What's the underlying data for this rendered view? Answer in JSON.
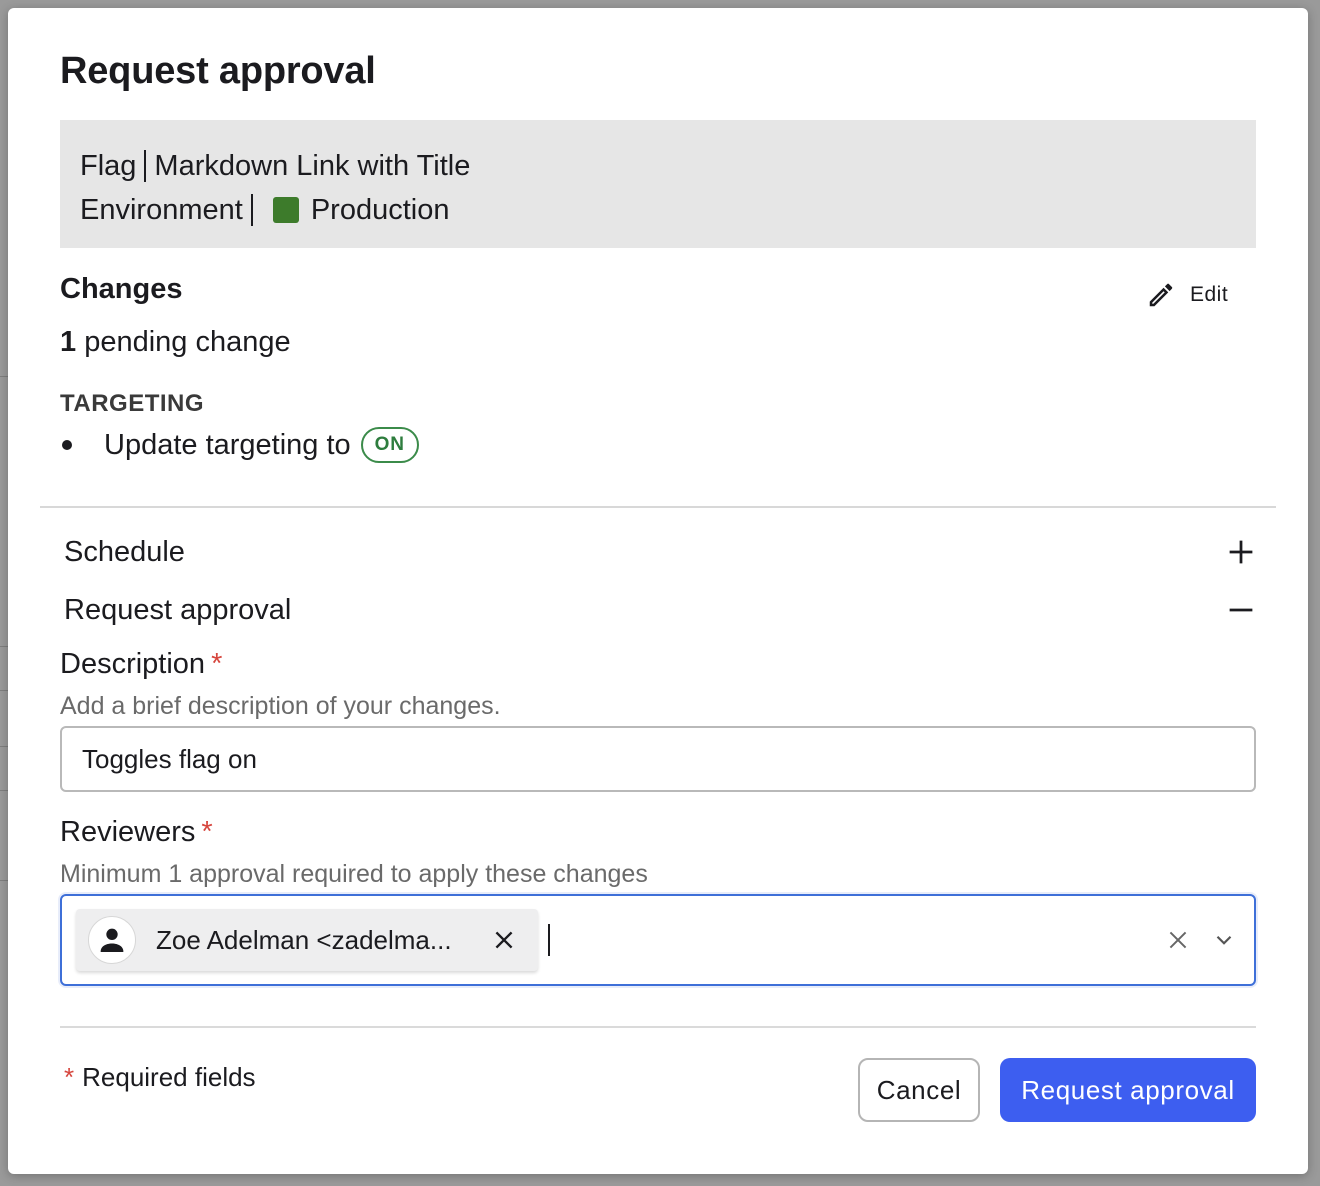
{
  "modal": {
    "title": "Request approval"
  },
  "summary": {
    "flag_label": "Flag",
    "flag_name": "Markdown Link with Title",
    "environment_label": "Environment",
    "environment_name": "Production",
    "environment_color": "#3d7b2b"
  },
  "changes": {
    "heading": "Changes",
    "edit_label": "Edit",
    "pending_count": "1",
    "pending_text": "pending change",
    "section_heading": "TARGETING",
    "item_text": "Update targeting to",
    "item_badge": "ON"
  },
  "accordion": {
    "schedule_label": "Schedule",
    "request_label": "Request approval"
  },
  "description": {
    "label": "Description",
    "required_mark": "*",
    "hint": "Add a brief description of your changes.",
    "value": "Toggles flag on"
  },
  "reviewers": {
    "label": "Reviewers",
    "required_mark": "*",
    "hint": "Minimum 1 approval required to apply these changes",
    "selected": [
      {
        "label": "Zoe Adelman <zadelma..."
      }
    ]
  },
  "footer": {
    "required_mark": "*",
    "required_text": "Required fields",
    "cancel_label": "Cancel",
    "submit_label": "Request approval"
  },
  "colors": {
    "primary": "#3d5ef0",
    "required": "#d6453d",
    "on_badge": "#2e7d3e",
    "focus_border": "#3e6fd8"
  }
}
